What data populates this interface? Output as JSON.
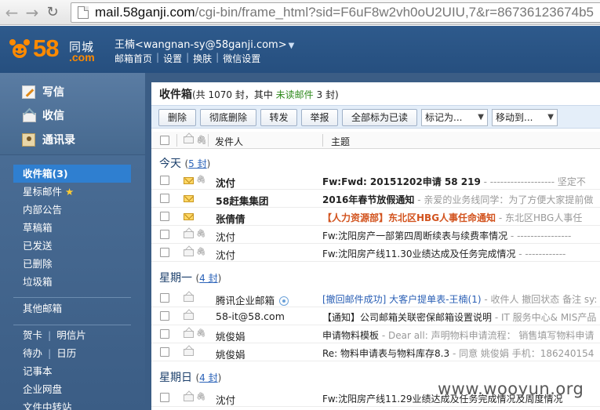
{
  "browser": {
    "url_host": "mail.58ganji.com",
    "url_path": "/cgi-bin/frame_html?sid=F6uF8w2vh0oU2UIU,7&r=86736123674b5"
  },
  "header": {
    "logo_number": "58",
    "logo_brand": "同城",
    "logo_domain": ".com",
    "user": "王楠<wangnan-sy@58ganji.com>",
    "user_caret": "▼",
    "links": [
      "邮箱首页",
      "设置",
      "换肤",
      "微信设置"
    ],
    "link_sep": "|"
  },
  "sidebar": {
    "compose": "写信",
    "inbox": "收信",
    "contacts": "通讯录",
    "folders": [
      {
        "label": "收件箱(3)"
      },
      {
        "label": "星标邮件",
        "star": "★"
      },
      {
        "label": "内部公告"
      },
      {
        "label": "草稿箱"
      },
      {
        "label": "已发送"
      },
      {
        "label": "已删除"
      },
      {
        "label": "垃圾箱"
      }
    ],
    "other_mailboxes": "其他邮箱",
    "tools": [
      {
        "left": "贺卡",
        "right": "明信片"
      },
      {
        "left": "待办",
        "right": "日历"
      }
    ],
    "extras": [
      "记事本",
      "企业网盘",
      "文件中转站"
    ]
  },
  "main": {
    "title": "收件箱",
    "count_prefix": "(共 1070 封，其中 ",
    "unread_label": "未读邮件",
    "count_suffix": " 3 封)",
    "toolbar": {
      "delete": "删除",
      "delete_permanently": "彻底删除",
      "forward": "转发",
      "report": "举报",
      "mark_all_read": "全部标为已读",
      "mark_as": "标记为...",
      "move_to": "移动到..."
    },
    "columns": {
      "sender": "发件人",
      "subject": "主题"
    },
    "groups": [
      {
        "label": "今天",
        "count_open": "(",
        "count": "5 封",
        "count_close": ")",
        "rows": [
          {
            "sender": "沈付",
            "subject": "Fw:Fwd: 20151202申请 58 219",
            "preview": " - ------------------- 坚定不",
            "unread": true,
            "attach": true
          },
          {
            "sender": "58赶集集团",
            "subject": "2016年春节放假通知",
            "preview": " - 亲爱的业务线同学：为了方便大家提前做",
            "unread": true,
            "attach": false
          },
          {
            "sender": "张倩倩",
            "subject": "【人力资源部】东北区HBG人事任命通知",
            "preview": " - 东北区HBG人事任",
            "unread": true,
            "attach": false
          },
          {
            "sender": "沈付",
            "subject": "Fw:沈阳房产一部第四周断续表与续费率情况",
            "preview": " - ----------------",
            "unread": false,
            "attach": true
          },
          {
            "sender": "沈付",
            "subject": "Fw:沈阳房产线11.30业绩达成及任务完成情况",
            "preview": " - ------------",
            "unread": false,
            "attach": true
          }
        ]
      },
      {
        "label": "星期一",
        "count_open": "(",
        "count": "4 封",
        "count_close": ")",
        "rows": [
          {
            "sender": "腾讯企业邮箱",
            "subject": "[撤回邮件成功] 大客户提单表-王楠(1)",
            "preview": " - 收件人 撤回状态 备注 sy:",
            "unread": false,
            "attach": false
          },
          {
            "sender": "58-it@58.com",
            "subject": "【通知】公司邮箱关联密保邮箱设置说明",
            "preview": " - IT 服务中心& MIS产品",
            "unread": false,
            "attach": false
          },
          {
            "sender": "姚俊娟",
            "subject": "申请物料模板",
            "preview": " - Dear all: 声明物料申请流程： 销售填写物料申请",
            "unread": false,
            "attach": true
          },
          {
            "sender": "姚俊娟",
            "subject": "Re: 物料申请表与物料库存8.3",
            "preview": " - 同意 姚俊娟 手机：186240154",
            "unread": false,
            "attach": false
          }
        ]
      },
      {
        "label": "星期日",
        "count_open": "(",
        "count": "4 封",
        "count_close": ")",
        "rows": [
          {
            "sender": "沈付",
            "subject": "Fw:沈阳房产线11.29业绩达成及任务完成情况及周度情况",
            "preview": "",
            "unread": false,
            "attach": true
          }
        ]
      }
    ]
  },
  "watermark": "www.wooyun.org"
}
